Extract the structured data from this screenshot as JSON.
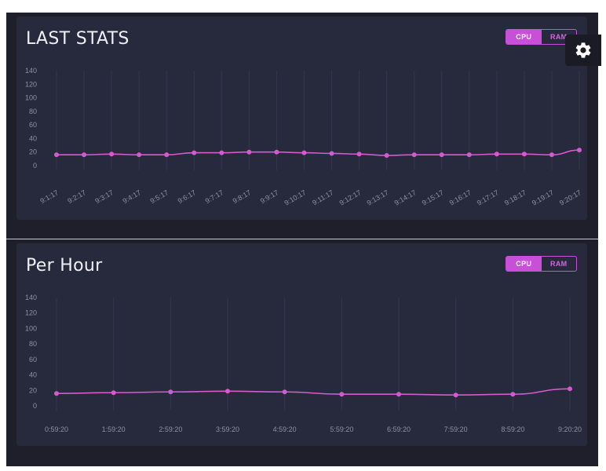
{
  "colors": {
    "accent": "#c84fd8",
    "line": "#d45ad0",
    "card": "#272a3c",
    "frame": "#1e1f2b"
  },
  "settings": {
    "icon": "gear-icon"
  },
  "panels": [
    {
      "title": "LAST STATS",
      "toggle": {
        "cpu": "CPU",
        "ram": "RAM",
        "active": "CPU"
      },
      "chart_data": {
        "type": "line",
        "x": [
          "9:1:17",
          "9:2:17",
          "9:3:17",
          "9:4:17",
          "9:5:17",
          "9:6:17",
          "9:7:17",
          "9:8:17",
          "9:9:17",
          "9:10:17",
          "9:11:17",
          "9:12:17",
          "9:13:17",
          "9:14:17",
          "9:15:17",
          "9:16:17",
          "9:17:17",
          "9:18:17",
          "9:19:17",
          "9:20:17"
        ],
        "y": [
          16,
          16,
          17,
          16,
          16,
          19,
          19,
          20,
          20,
          19,
          18,
          17,
          15,
          16,
          16,
          16,
          17,
          17,
          16,
          23
        ],
        "yticks": [
          140,
          120,
          100,
          80,
          60,
          40,
          20,
          0
        ],
        "ylim": [
          0,
          140
        ],
        "xlabel_rotation": -30,
        "grid": "vertical"
      }
    },
    {
      "title": "Per Hour",
      "toggle": {
        "cpu": "CPU",
        "ram": "RAM",
        "active": "CPU"
      },
      "chart_data": {
        "type": "line",
        "x": [
          "0:59:20",
          "1:59:20",
          "2:59:20",
          "3:59:20",
          "4:59:20",
          "5:59:20",
          "6:59:20",
          "7:59:20",
          "8:59:20",
          "9:20:20"
        ],
        "y": [
          16,
          17,
          18,
          19,
          18,
          15,
          15,
          14,
          15,
          22
        ],
        "yticks": [
          140,
          120,
          100,
          80,
          60,
          40,
          20,
          0
        ],
        "ylim": [
          0,
          140
        ],
        "xlabel_rotation": 0,
        "grid": "vertical"
      }
    }
  ]
}
